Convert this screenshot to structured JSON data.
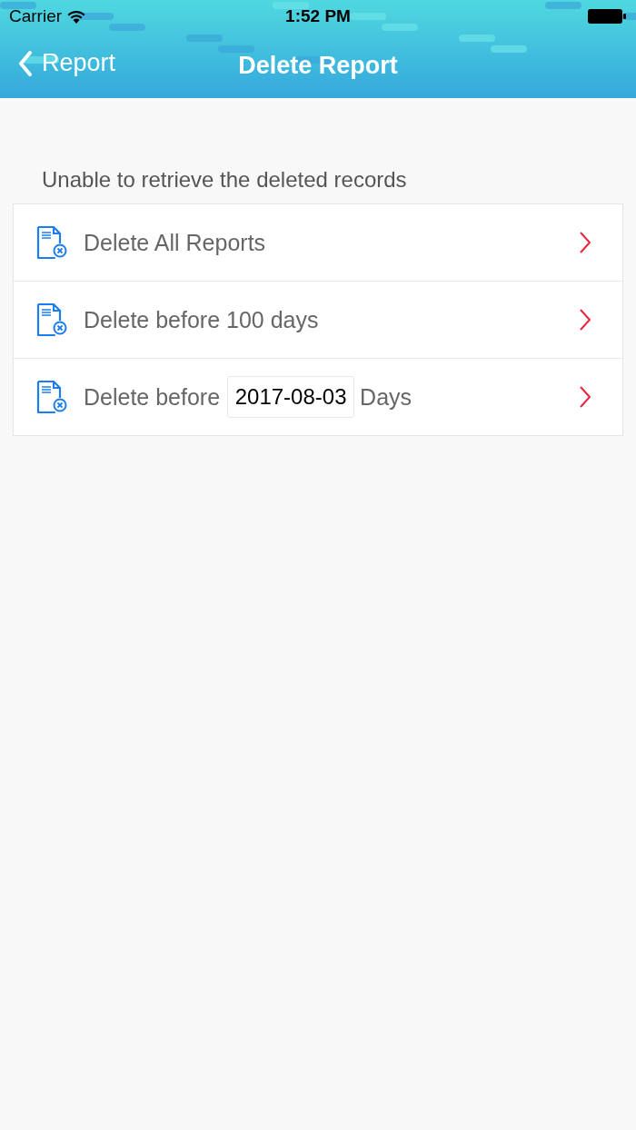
{
  "status_bar": {
    "carrier": "Carrier",
    "time": "1:52 PM"
  },
  "nav_bar": {
    "back_label": "Report",
    "title": "Delete Report"
  },
  "note": "Unable to retrieve the deleted records",
  "options": [
    {
      "kind": "plain",
      "label": "Delete All Reports"
    },
    {
      "kind": "plain",
      "label": "Delete before 100 days"
    },
    {
      "kind": "date",
      "label": "Delete before",
      "value": "2017-08-03",
      "suffix": "Days"
    }
  ]
}
